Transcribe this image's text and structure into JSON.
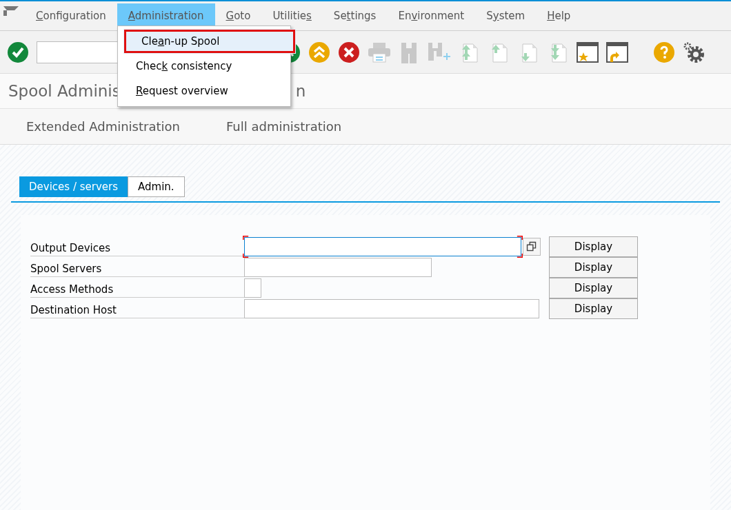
{
  "menu_bar": {
    "items": [
      {
        "key": "C",
        "post": "onfiguration",
        "selected": false
      },
      {
        "key": "A",
        "post": "dministration",
        "selected": true
      },
      {
        "key": "G",
        "post": "oto",
        "selected": false
      },
      {
        "pre": "Utilitie",
        "key": "s",
        "selected": false
      },
      {
        "pre": "Se",
        "key": "t",
        "post": "tings",
        "selected": false
      },
      {
        "pre": "En",
        "key": "v",
        "post": "ironment",
        "selected": false
      },
      {
        "pre": "S",
        "key": "y",
        "post": "stem",
        "selected": false
      },
      {
        "key": "H",
        "post": "elp",
        "selected": false
      }
    ]
  },
  "dropdown": {
    "items": [
      {
        "pre": "Cle",
        "key": "a",
        "post": "n-up Spool",
        "selected": true
      },
      {
        "pre": "Chec",
        "key": "k",
        "post": " consistency",
        "selected": false
      },
      {
        "key": "R",
        "post": "equest overview",
        "selected": false
      }
    ]
  },
  "title": {
    "start": "Spool Adminis",
    "end": "n"
  },
  "app_toolbar": [
    "Extended Administration",
    "Full administration"
  ],
  "tabs": [
    {
      "label": "Devices / servers",
      "selected": true
    },
    {
      "label": "Admin.",
      "selected": false
    }
  ],
  "form": {
    "rows": [
      {
        "label": "Output Devices",
        "kind": "long",
        "focused": true,
        "button": "Display"
      },
      {
        "label": "Spool Servers",
        "kind": "medium",
        "focused": false,
        "button": "Display"
      },
      {
        "label": "Access Methods",
        "kind": "tiny",
        "focused": false,
        "button": "Display"
      },
      {
        "label": "Destination Host",
        "kind": "wide",
        "focused": false,
        "button": "Display"
      }
    ]
  }
}
